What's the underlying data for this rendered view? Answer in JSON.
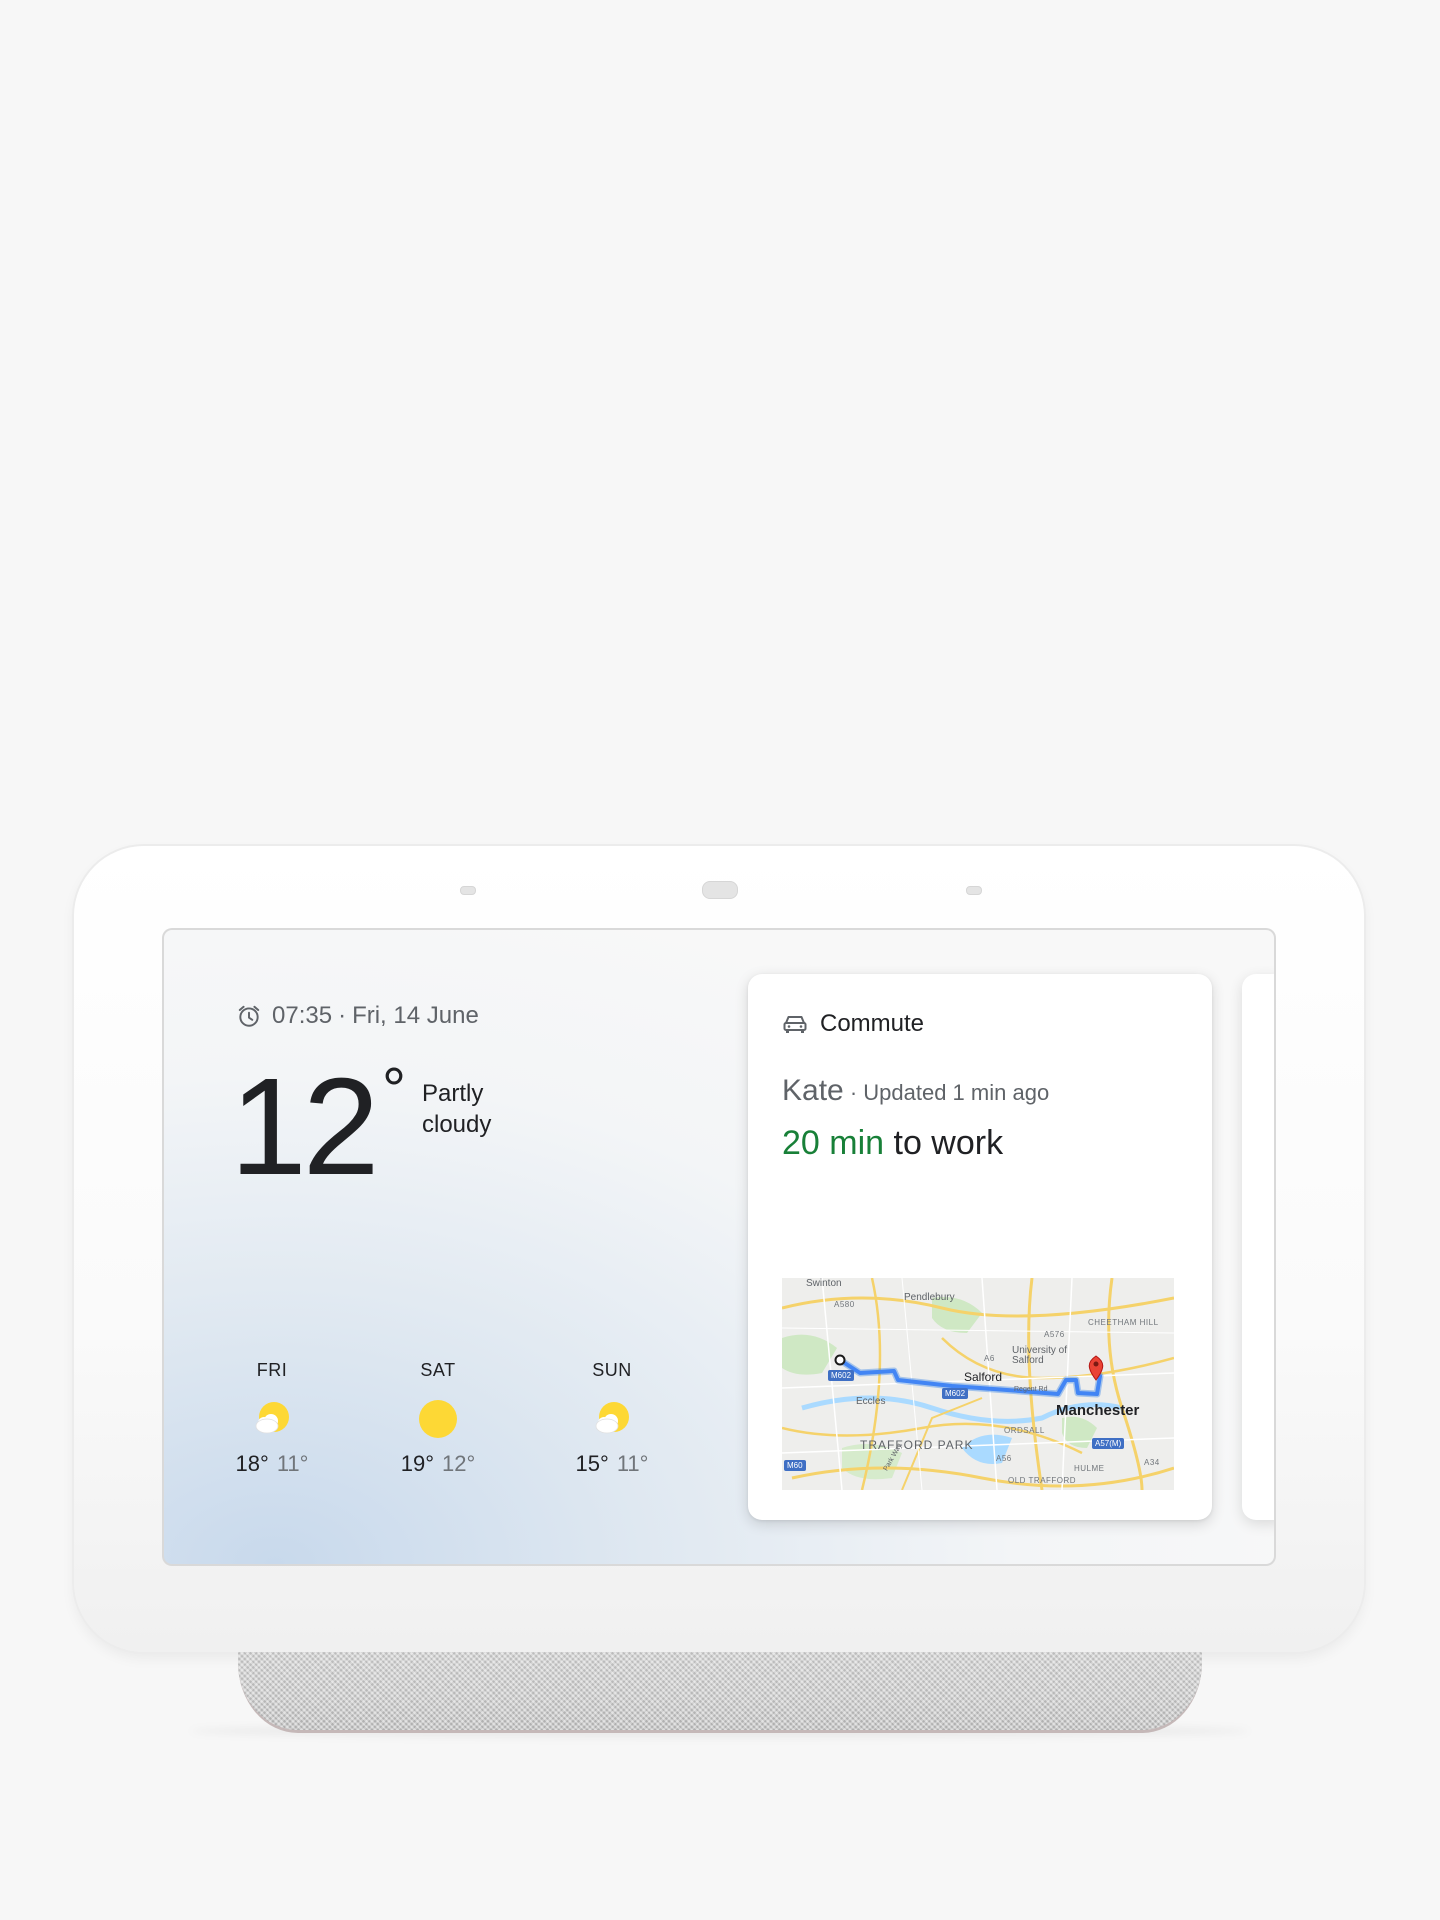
{
  "weather": {
    "time": "07:35",
    "separator": "·",
    "date": "Fri, 14 June",
    "temperature": "12",
    "unit": "°",
    "condition": "Partly cloudy",
    "forecast": [
      {
        "day": "FRI",
        "high": "18°",
        "low": "11°",
        "icon": "partly-cloudy-icon"
      },
      {
        "day": "SAT",
        "high": "19°",
        "low": "12°",
        "icon": "sunny-icon"
      },
      {
        "day": "SUN",
        "high": "15°",
        "low": "11°",
        "icon": "partly-cloudy-icon"
      }
    ]
  },
  "commute": {
    "title": "Commute",
    "name": "Kate",
    "updated": " · Updated 1 min ago",
    "duration": "20 min",
    "destination": " to work",
    "colors": {
      "duration": "#188038",
      "route": "#4285f4",
      "pin": "#ea4335"
    },
    "map": {
      "cities": [
        "Manchester",
        "Salford"
      ],
      "districts": [
        "TRAFFORD PARK",
        "CHEETHAM HILL",
        "ORDSALL",
        "HULME",
        "OLD TRAFFORD"
      ],
      "places": [
        "Swinton",
        "Pendlebury",
        "Eccles",
        "University of Salford",
        "Regent Rd",
        "Park Way"
      ],
      "roads": [
        "A580",
        "A576",
        "A6",
        "M602",
        "M602",
        "M60",
        "A57(M)",
        "A34",
        "A56"
      ]
    }
  }
}
